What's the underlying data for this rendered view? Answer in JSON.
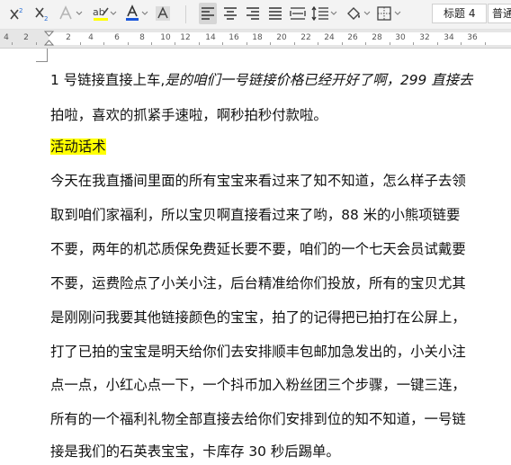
{
  "toolbar": {
    "styles": [
      "标题 4",
      "普通"
    ]
  },
  "ruler": {
    "labels": [
      "4",
      "2",
      "2",
      "4",
      "6",
      "8",
      "10",
      "12",
      "14",
      "16",
      "18",
      "20",
      "22",
      "24",
      "26",
      "28",
      "30",
      "32",
      "34",
      "36"
    ]
  },
  "document": {
    "para1_line1_normal": "1 号链接直接上车,",
    "para1_line1_italic": "是的咱们一号链接价格已经开好了啊，299 直接去",
    "para1_line2": "拍啦，喜欢的抓紧手速啦，啊秒拍秒付款啦。",
    "heading": "活动话术",
    "body_lines": [
      "今天在我直播间里面的所有宝宝来看过来了知不知道，怎么样子去领",
      "取到咱们家福利，所以宝贝啊直接看过来了哟，88 米的小熊项链要",
      "不要，两年的机芯质保免费延长要不要，咱们的一个七天会员试戴要",
      "不要，运费险点了小关小注，后台精准给你们投放，所有的宝贝尤其",
      "是刚刚问我要其他链接颜色的宝宝，拍了的记得把已拍打在公屏上，",
      "打了已拍的宝宝是明天给你们去安排顺丰包邮加急发出的，小关小注",
      "点一点，小红心点一下，一个抖币加入粉丝团三个步骤，一键三连，",
      "所有的一个福利礼物全部直接去给你们安排到位的知不知道，一号链",
      "接是我们的石英表宝宝，卡库存 30 秒后踢单。"
    ]
  }
}
